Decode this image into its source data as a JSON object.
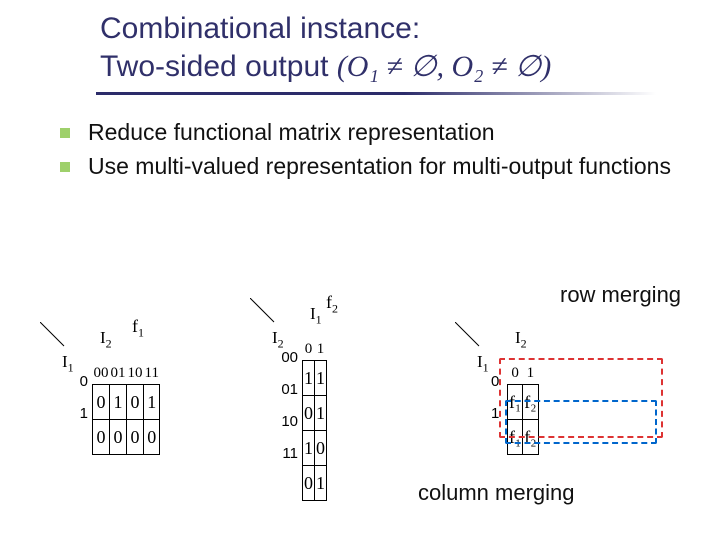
{
  "title": {
    "line1": "Combinational instance:",
    "line2_prefix": "Two-sided output ",
    "line2_math": "(O₁ ≠ ∅, O₂ ≠ ∅)"
  },
  "bullets": [
    "Reduce functional matrix representation",
    "Use multi-valued representation for multi-output functions"
  ],
  "annotations": {
    "row_merging": "row merging",
    "column_merging": "column merging"
  },
  "table1": {
    "f_label": "f",
    "f_sub": "1",
    "row_axis": "I",
    "row_axis_sub": "1",
    "col_axis": "I",
    "col_axis_sub": "2",
    "col_headers": [
      "00",
      "01",
      "10",
      "11"
    ],
    "row_headers": [
      "0",
      "1"
    ],
    "cells": [
      [
        "0",
        "1",
        "0",
        "1"
      ],
      [
        "0",
        "0",
        "0",
        "0"
      ]
    ]
  },
  "table2": {
    "f_label": "f",
    "f_sub": "2",
    "row_axis": "I",
    "row_axis_sub": "2",
    "col_axis": "I",
    "col_axis_sub": "1",
    "col_headers": [
      "0",
      "1"
    ],
    "row_headers": [
      "00",
      "01",
      "10",
      "11"
    ],
    "cells": [
      [
        "1",
        "1"
      ],
      [
        "0",
        "1"
      ],
      [
        "1",
        "0"
      ],
      [
        "0",
        "1"
      ]
    ]
  },
  "table3": {
    "row_axis": "I",
    "row_axis_sub": "1",
    "col_axis": "I",
    "col_axis_sub": "2",
    "col_headers": [
      "0",
      "1"
    ],
    "row_headers": [
      "0",
      "1"
    ],
    "cells": [
      [
        "f₁",
        "f₂"
      ],
      [
        "f₁",
        "f₂"
      ]
    ]
  }
}
